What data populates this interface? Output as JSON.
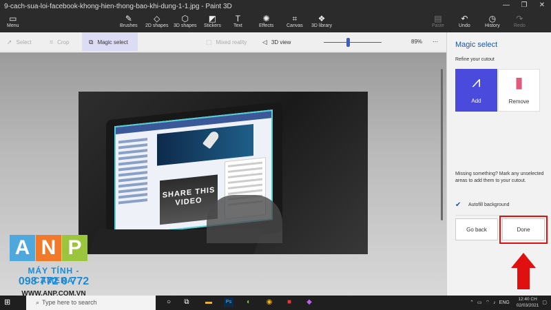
{
  "window": {
    "title": "9-cach-sua-loi-facebook-khong-hien-thong-bao-khi-dung-1-1.jpg - Paint 3D",
    "controls": [
      "—",
      "❐",
      "✕"
    ]
  },
  "toolbar": {
    "menu": "Menu",
    "tools": [
      {
        "label": "Brushes",
        "icon": "brush-icon"
      },
      {
        "label": "2D shapes",
        "icon": "2d-shapes-icon"
      },
      {
        "label": "3D shapes",
        "icon": "3d-shapes-icon"
      },
      {
        "label": "Stickers",
        "icon": "stickers-icon"
      },
      {
        "label": "Text",
        "icon": "text-icon"
      },
      {
        "label": "Effects",
        "icon": "effects-icon"
      },
      {
        "label": "Canvas",
        "icon": "canvas-icon"
      },
      {
        "label": "3D library",
        "icon": "3d-library-icon"
      }
    ],
    "paste": "Paste",
    "undo": "Undo",
    "history": "History",
    "redo": "Redo"
  },
  "subbar": {
    "select": "Select",
    "crop": "Crop",
    "magic_select": "Magic select",
    "mixed_reality": "Mixed reality",
    "view_3d": "3D view",
    "zoom": "89%",
    "zoom_fraction": 0.42
  },
  "photo": {
    "video_text": "SHARE THIS VIDEO"
  },
  "panel": {
    "title": "Magic select",
    "subtitle": "Refine your cutout",
    "add": "Add",
    "remove": "Remove",
    "help": "Missing something? Mark any unselected areas to add them to your cutout.",
    "autofill": "Autofill background",
    "autofill_checked": true,
    "go_back": "Go back",
    "done": "Done"
  },
  "watermark": {
    "letters": [
      "A",
      "N",
      "P"
    ],
    "tagline": "MÁY TÍNH - CAMERA",
    "phone": "098 772 0 772",
    "website": "WWW.ANP.COM.VN"
  },
  "taskbar": {
    "search_placeholder": "Type here to search",
    "language": "ENG",
    "time": "12:40 CH",
    "date": "02/03/2021"
  },
  "colors": {
    "accent": "#1c55a8",
    "add_tile": "#4a4adc",
    "highlight": "#e01010"
  }
}
